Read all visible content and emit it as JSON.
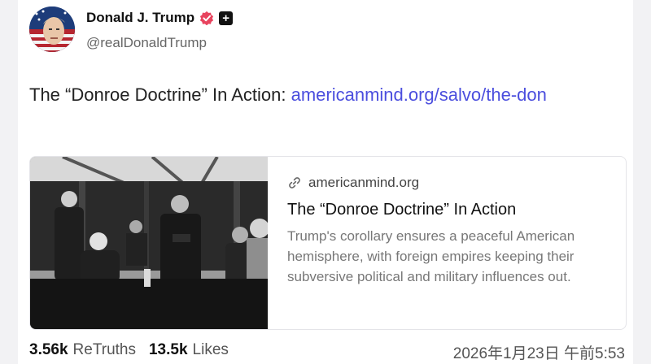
{
  "post": {
    "author": {
      "display_name": "Donald J. Trump",
      "handle": "@realDonaldTrump",
      "verified_icon": "verified-badge-icon",
      "plus_badge": "+"
    },
    "text": "The “Donroe Doctrine” In Action: ",
    "link_text": "americanmind.org/salvo/the-don"
  },
  "link_preview": {
    "domain": "americanmind.org",
    "title": "The “Donroe Doctrine” In Action",
    "description": "Trump's corollary ensures a peaceful American hemisphere, with foreign empires keeping their subversive political and military influences out."
  },
  "stats": {
    "retruths_count": "3.56k",
    "retruths_label": "ReTruths",
    "likes_count": "13.5k",
    "likes_label": "Likes",
    "timestamp": "2026年1月23日 午前5:53"
  },
  "colors": {
    "link": "#4b4ede",
    "verified": "#e8445e"
  }
}
